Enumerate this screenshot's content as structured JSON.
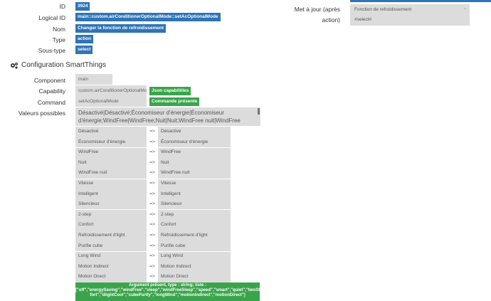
{
  "info": {
    "id_label": "ID",
    "id_value": "3924",
    "logical_label": "Logical ID",
    "logical_value": "main::custom.airConditionerOptionalMode::setAcOptionalMode",
    "name_label": "Nom",
    "name_value": "Changer la fonction de refroidissement",
    "type_label": "Type",
    "type_value": "action",
    "subtype_label": "Sous-type",
    "subtype_value": "select"
  },
  "update": {
    "label": "Met à jour (après action)",
    "label_line1": "Met à jour (après",
    "label_line2": "action)",
    "box_line1": "Fonction de refroidissement",
    "box_line2": "#select#"
  },
  "section": {
    "title": "Configuration SmartThings",
    "icon": "gears-icon"
  },
  "config": {
    "component_label": "Component",
    "component_value": "main",
    "capability_label": "Capability",
    "capability_value": "custom.airConditionerOptionalMo",
    "capability_badge": "Json capabilities",
    "command_label": "Command",
    "command_value": "setAcOptionalMode",
    "command_badge": "Commande présente",
    "values_label": "Valeurs possibles",
    "values_text": "Désactivé|Désactivé;Économiseur d'énergie|Économiseur d'énergie;WindFree|WindFree;Nuit|Nuit;WindFree nuit|WindFree"
  },
  "mappings": [
    {
      "from": "Désactivé",
      "to": "Désactivé"
    },
    {
      "from": "Économiseur d'énergie",
      "to": "Économiseur d'énergie"
    },
    {
      "from": "WindFree",
      "to": "WindFree"
    },
    {
      "from": "Nuit",
      "to": "Nuit"
    },
    {
      "from": "WindFree nuit",
      "to": "WindFree nuit"
    },
    {
      "from": "Vitesse",
      "to": "Vitesse"
    },
    {
      "from": "Intelligent",
      "to": "Intelligent"
    },
    {
      "from": "Silencieux",
      "to": "Silencieux"
    },
    {
      "from": "2-step",
      "to": "2-step"
    },
    {
      "from": "Confort",
      "to": "Confort"
    },
    {
      "from": "Refroidissement d'light",
      "to": "Refroidissement d'light"
    },
    {
      "from": "Purifie cube",
      "to": "Purifie cube"
    },
    {
      "from": "Long Wind",
      "to": "Long Wind"
    },
    {
      "from": "Motion Indirect",
      "to": "Motion Indirect"
    },
    {
      "from": "Motion Direct",
      "to": "Motion Direct"
    }
  ],
  "arrow": "=>",
  "argument": {
    "line1": "Argument présent, type : string; liste :",
    "line2": "[\"off\",\"energySaving\",\"windFree\",\"sleep\",\"windFreeSleep\",\"speed\",\"smart\",\"quiet\",\"twoStep\",\"com",
    "line3": "fort\",\"dlightCool\",\"cubePurify\",\"longWind\",\"motionIndirect\",\"motionDirect\"]"
  },
  "colors": {
    "accent_blue": "#2f74b5",
    "accent_green": "#3aa44b",
    "field_gray": "#dcdcdc"
  }
}
